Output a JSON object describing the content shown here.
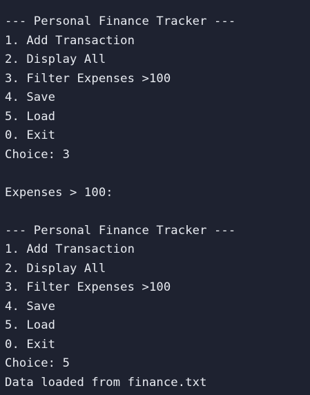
{
  "terminal": {
    "lines": [
      "--- Personal Finance Tracker ---",
      "1. Add Transaction",
      "2. Display All",
      "3. Filter Expenses >100",
      "4. Save",
      "5. Load",
      "0. Exit",
      "Choice: 3",
      "",
      "Expenses > 100:",
      "",
      "--- Personal Finance Tracker ---",
      "1. Add Transaction",
      "2. Display All",
      "3. Filter Expenses >100",
      "4. Save",
      "5. Load",
      "0. Exit",
      "Choice: 5",
      "Data loaded from finance.txt"
    ],
    "colors": {
      "background": "#1e2230",
      "text": "#e8ebf1"
    }
  }
}
